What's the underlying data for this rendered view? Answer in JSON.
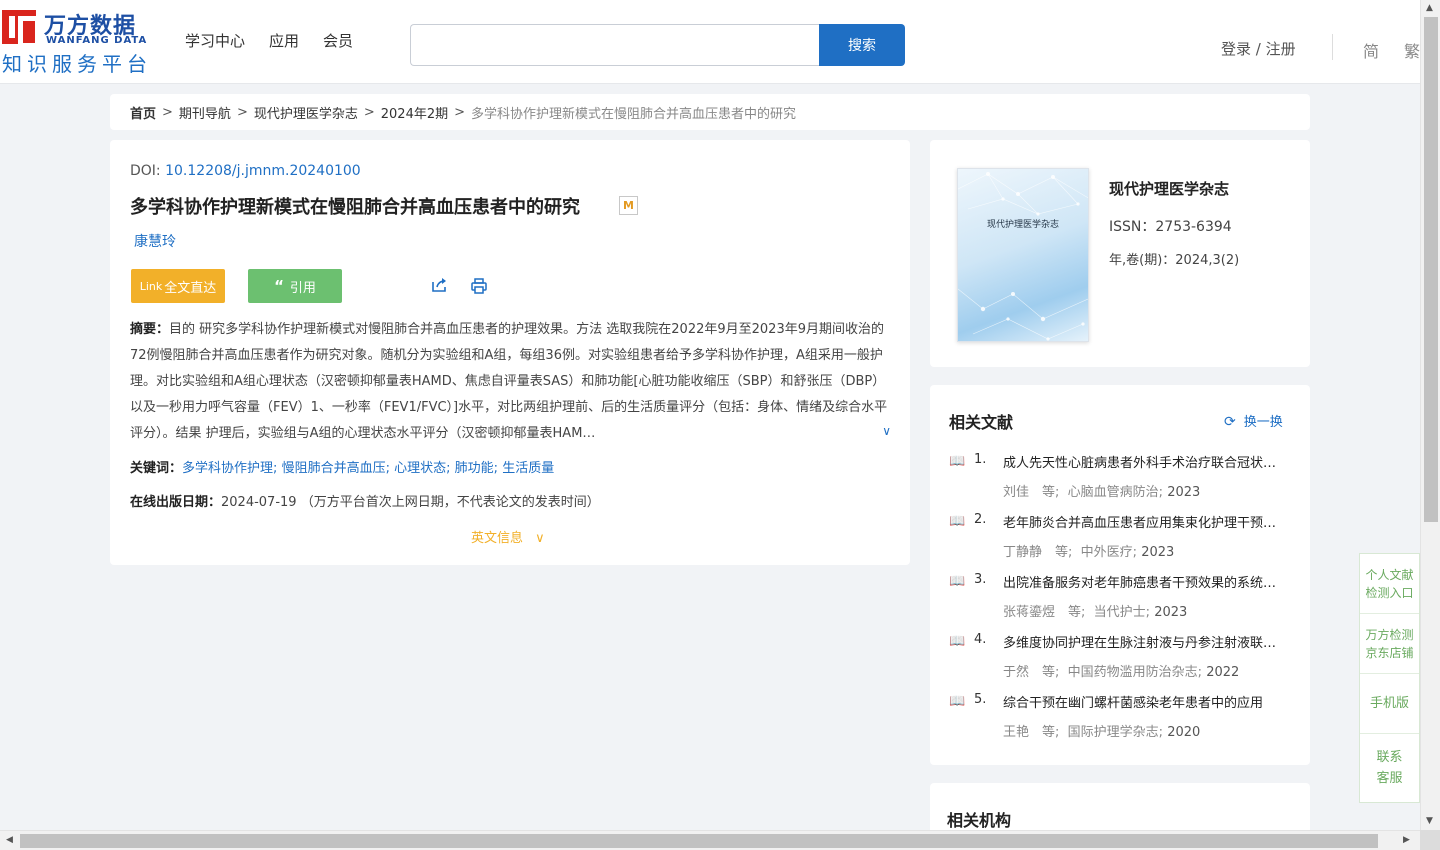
{
  "header": {
    "logo_cn": "万方数据",
    "logo_en": "WANFANG DATA",
    "logo_sub": "知识服务平台",
    "nav": [
      "学习中心",
      "应用",
      "会员"
    ],
    "search_button": "搜索",
    "search_value": "",
    "login": "登录 / 注册",
    "lang_simplified": "简",
    "lang_traditional": "繁"
  },
  "breadcrumb": [
    "首页",
    "期刊导航",
    "现代护理医学杂志",
    "2024年2期",
    "多学科协作护理新模式在慢阻肺合并高血压患者中的研究"
  ],
  "article": {
    "doi_label": "DOI:",
    "doi": "10.12208/j.jmnm.20240100",
    "title": "多学科协作护理新模式在慢阻肺合并高血压患者中的研究",
    "badge": "M",
    "author": "康慧玲",
    "btn_fulltext": "全文直达",
    "btn_fulltext_icon": "Link",
    "btn_cite": "引用",
    "abstract_label": "摘要：",
    "abstract": "目的 研究多学科协作护理新模式对慢阻肺合并高血压患者的护理效果。方法 选取我院在2022年9月至2023年9月期间收治的72例慢阻肺合并高血压患者作为研究对象。随机分为实验组和A组，每组36例。对实验组患者给予多学科协作护理，A组采用一般护理。对比实验组和A组心理状态（汉密顿抑郁量表HAMD、焦虑自评量表SAS）和肺功能[心脏功能收缩压（SBP）和舒张压（DBP）以及一秒用力呼气容量（FEV）1、一秒率（FEV1/FVC）]水平，对比两组护理前、后的生活质量评分（包括：身体、情绪及综合水平评分）。结果 护理后，实验组与A组的心理状态水平评分（汉密顿抑郁量表HAM…",
    "keywords_label": "关键词：",
    "keywords": [
      "多学科协作护理",
      "慢阻肺合并高血压",
      "心理状态",
      "肺功能",
      "生活质量"
    ],
    "pubdate_label": "在线出版日期：",
    "pubdate": "2024-07-19",
    "pubdate_note": "（万方平台首次上网日期，不代表论文的发表时间）",
    "english_info": "英文信息"
  },
  "journal": {
    "cover_title": "现代护理医学杂志",
    "name": "现代护理医学杂志",
    "issn": "ISSN：2753-6394",
    "year_vol": "年,卷(期)：2024,3(2)"
  },
  "related": {
    "heading": "相关文献",
    "refresh": "换一换",
    "items": [
      {
        "num": "1.",
        "title": "成人先天性心脏病患者外科手术治疗联合冠状动脉旁路移植术的临床研究",
        "authors": "刘佳　等;",
        "source": "心脑血管病防治;",
        "year": "2023"
      },
      {
        "num": "2.",
        "title": "老年肺炎合并高血压患者应用集束化护理干预的效果",
        "authors": "丁静静　等;",
        "source": "中外医疗;",
        "year": "2023"
      },
      {
        "num": "3.",
        "title": "出院准备服务对老年肺癌患者干预效果的系统评价",
        "authors": "张蒋鎏煜　等;",
        "source": "当代护士;",
        "year": "2023"
      },
      {
        "num": "4.",
        "title": "多维度协同护理在生脉注射液与丹参注射液联合使用中的应用",
        "authors": "于然　等;",
        "source": "中国药物滥用防治杂志;",
        "year": "2022"
      },
      {
        "num": "5.",
        "title": "综合干预在幽门螺杆菌感染老年患者中的应用",
        "authors": "王艳　等;",
        "source": "国际护理学杂志;",
        "year": "2020"
      }
    ]
  },
  "orgs": {
    "heading": "相关机构"
  },
  "sidebar": [
    {
      "label": "个人文献检测入口",
      "lines": [
        "个人文献",
        "检测入口"
      ]
    },
    {
      "label": "万方检测京东店铺",
      "lines": [
        "万方检测",
        "京东店铺"
      ]
    },
    {
      "label": "手机版",
      "lines": [
        "手机版"
      ]
    },
    {
      "label": "联系客服",
      "lines": [
        "联系",
        "客服"
      ]
    }
  ],
  "colors": {
    "brand_blue": "#1f6fc4",
    "logo_red": "#d9251d",
    "fulltext_orange": "#f2b029",
    "cite_green": "#6cc070",
    "side_green": "#6aaa5f"
  }
}
